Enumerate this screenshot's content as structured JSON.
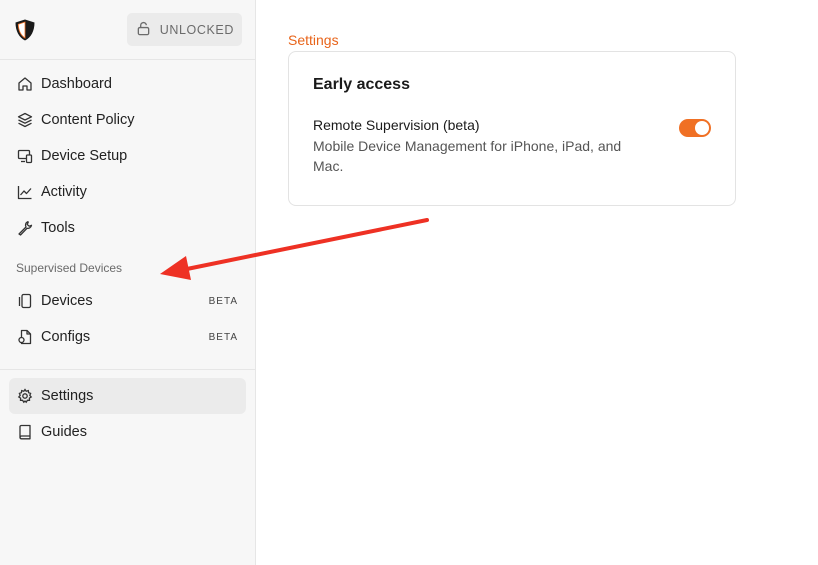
{
  "sidebar": {
    "lock_label": "UNLOCKED",
    "primary_items": [
      {
        "label": "Dashboard",
        "icon": "home-icon"
      },
      {
        "label": "Content Policy",
        "icon": "layers-icon"
      },
      {
        "label": "Device Setup",
        "icon": "device-setup-icon"
      },
      {
        "label": "Activity",
        "icon": "activity-chart-icon"
      },
      {
        "label": "Tools",
        "icon": "wrench-icon"
      }
    ],
    "section_label": "Supervised Devices",
    "supervised_items": [
      {
        "label": "Devices",
        "badge": "BETA",
        "icon": "devices-icon"
      },
      {
        "label": "Configs",
        "badge": "BETA",
        "icon": "config-file-icon"
      }
    ],
    "bottom_items": [
      {
        "label": "Settings",
        "icon": "gear-icon",
        "active": true
      },
      {
        "label": "Guides",
        "icon": "book-icon"
      }
    ]
  },
  "main": {
    "breadcrumb": "Settings",
    "card": {
      "title": "Early access",
      "setting": {
        "name": "Remote Supervision (beta)",
        "description": "Mobile Device Management for iPhone, iPad, and Mac.",
        "enabled": true
      }
    }
  },
  "colors": {
    "accent": "#e8641a",
    "toggle_on": "#f07024",
    "annotation_arrow": "#ee3124"
  }
}
